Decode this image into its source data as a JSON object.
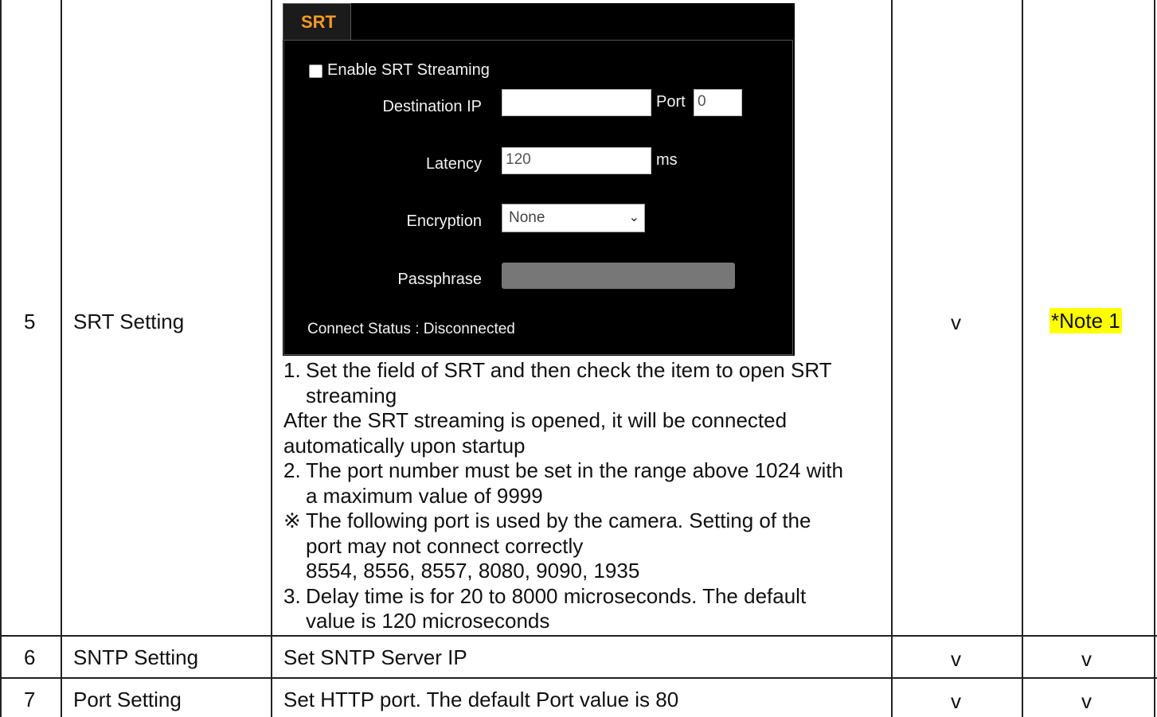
{
  "rows": [
    {
      "no": "5",
      "name": "SRT Setting",
      "col4": "v",
      "col5": "*Note 1"
    },
    {
      "no": "6",
      "name": "SNTP Setting",
      "desc": "Set SNTP Server IP",
      "col4": "v",
      "col5": "v"
    },
    {
      "no": "7",
      "name": "Port Setting",
      "desc": "Set HTTP port. The default Port value is 80",
      "col4": "v",
      "col5": "v"
    }
  ],
  "srt_panel": {
    "tab": "SRT",
    "enable_label": "Enable SRT Streaming",
    "enable_checked": false,
    "destination_ip_label": "Destination IP",
    "destination_ip_value": "",
    "port_label": "Port",
    "port_value": "0",
    "latency_label": "Latency",
    "latency_value": "120",
    "latency_unit": "ms",
    "encryption_label": "Encryption",
    "encryption_value": "None",
    "passphrase_label": "Passphrase",
    "connect_status": "Connect Status : Disconnected"
  },
  "srt_description": {
    "item1_num": "1.",
    "item1_line1": "Set the field of SRT and then check the item to open SRT",
    "item1_line2": "streaming",
    "para_line1": "After the SRT streaming is opened, it will be connected",
    "para_line2": "automatically upon startup",
    "item2_num": "2.",
    "item2_line1": "The port number must be set in the range above 1024 with",
    "item2_line2": "a maximum value of 9999",
    "note_mark": "※",
    "note_line1": "The following port is used by the camera. Setting of the",
    "note_line2": "port may not connect correctly",
    "note_line3": "8554, 8556, 8557, 8080, 9090, 1935",
    "item3_num": "3.",
    "item3_line1": "Delay time is for 20 to 8000 microseconds. The default",
    "item3_line2": "value is 120 microseconds"
  },
  "colors": {
    "tab_accent": "#f39a23",
    "highlight": "#ffff00",
    "panel_bg": "#000000"
  }
}
